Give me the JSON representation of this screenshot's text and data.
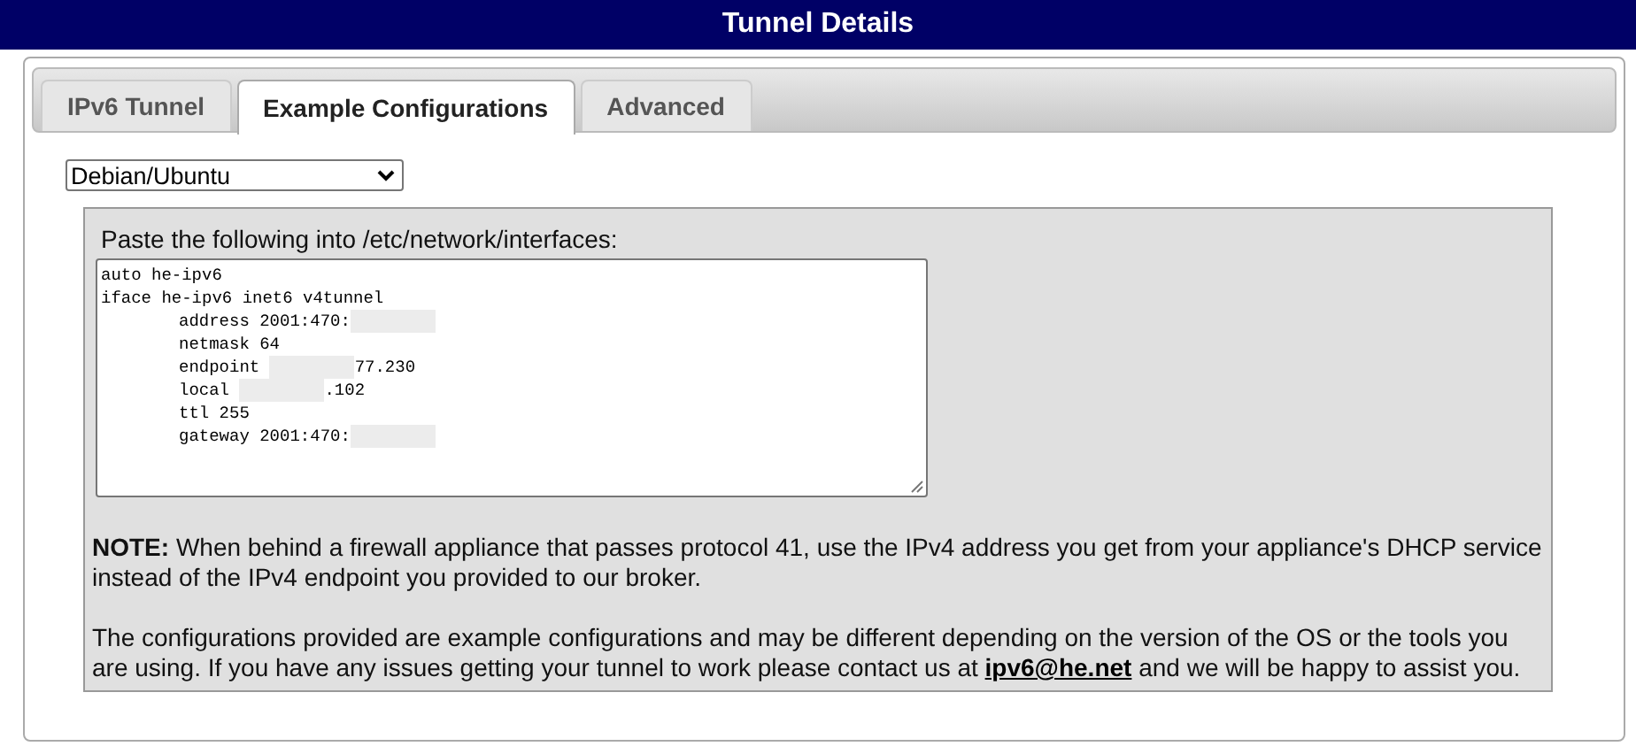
{
  "header": {
    "title": "Tunnel Details"
  },
  "tabs": [
    {
      "label": "IPv6 Tunnel",
      "selected": false
    },
    {
      "label": "Example Configurations",
      "selected": true
    },
    {
      "label": "Advanced",
      "selected": false
    }
  ],
  "os_select": {
    "value": "Debian/Ubuntu"
  },
  "config": {
    "instruction": "Paste the following into /etc/network/interfaces:",
    "lines": [
      {
        "indent": false,
        "parts": [
          {
            "kind": "text",
            "text": "auto he-ipv6"
          }
        ]
      },
      {
        "indent": false,
        "parts": [
          {
            "kind": "text",
            "text": "iface he-ipv6 inet6 v4tunnel"
          }
        ]
      },
      {
        "indent": true,
        "parts": [
          {
            "kind": "text",
            "text": "address 2001:470:"
          },
          {
            "kind": "redacted"
          }
        ]
      },
      {
        "indent": true,
        "parts": [
          {
            "kind": "text",
            "text": "netmask 64"
          }
        ]
      },
      {
        "indent": true,
        "parts": [
          {
            "kind": "text",
            "text": "endpoint "
          },
          {
            "kind": "redacted"
          },
          {
            "kind": "text",
            "text": "77.230"
          }
        ]
      },
      {
        "indent": true,
        "parts": [
          {
            "kind": "text",
            "text": "local "
          },
          {
            "kind": "redacted"
          },
          {
            "kind": "text",
            "text": ".102"
          }
        ]
      },
      {
        "indent": true,
        "parts": [
          {
            "kind": "text",
            "text": "ttl 255"
          }
        ]
      },
      {
        "indent": true,
        "parts": [
          {
            "kind": "text",
            "text": "gateway 2001:470:"
          },
          {
            "kind": "redacted"
          }
        ]
      }
    ]
  },
  "note": "**NOTE:** When behind a firewall appliance that passes protocol 41, use the IPv4 address you get from your appliance's DHCP service instead of the IPv4 endpoint you provided to our broker.",
  "disclaimer": {
    "before": "The configurations provided are example configurations and may be different depending on the version of the OS or the tools you are using. If you have any issues getting your tunnel to work please contact us at",
    "link": "ipv6@he.net",
    "after": "and we will be happy to assist you."
  }
}
